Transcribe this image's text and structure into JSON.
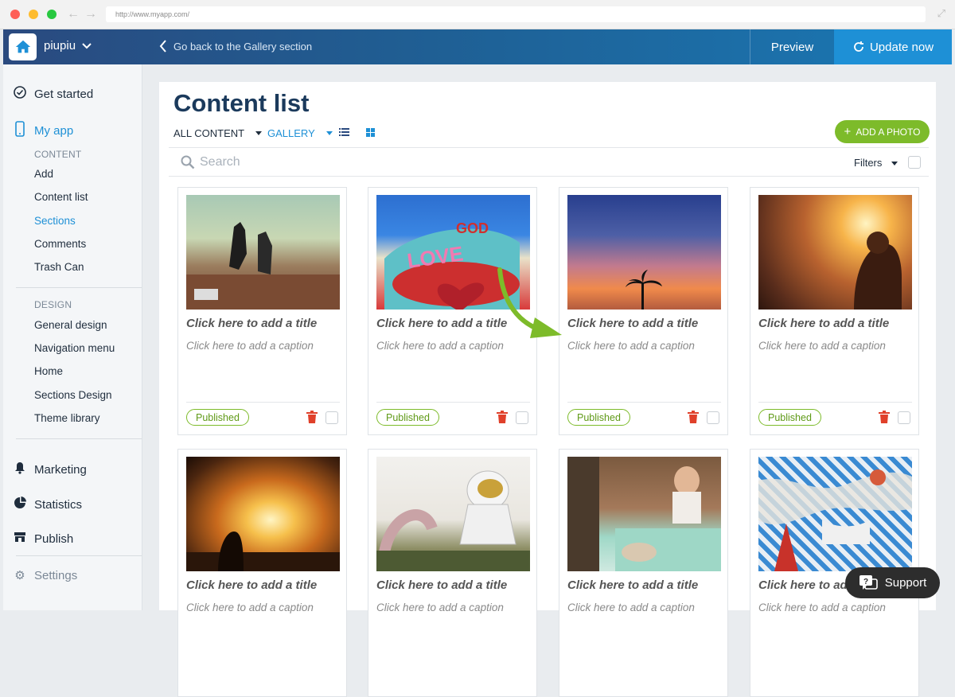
{
  "browser": {
    "url": "http://www.myapp.com/"
  },
  "header": {
    "app_name": "piupiu",
    "back_label": "Go back to the Gallery section",
    "preview_label": "Preview",
    "update_label": "Update now"
  },
  "sidebar": {
    "get_started": "Get started",
    "my_app": "My app",
    "content_heading": "CONTENT",
    "content_items": [
      "Add",
      "Content list",
      "Sections",
      "Comments",
      "Trash Can"
    ],
    "design_heading": "DESIGN",
    "design_items": [
      "General design",
      "Navigation menu",
      "Home",
      "Sections Design",
      "Theme library"
    ],
    "marketing": "Marketing",
    "statistics": "Statistics",
    "publish": "Publish",
    "settings": "Settings",
    "active_item": "Sections"
  },
  "main": {
    "title": "Content list",
    "filter_all": "ALL CONTENT",
    "filter_gallery": "GALLERY",
    "add_photo": "ADD A PHOTO",
    "search_placeholder": "Search",
    "filters_label": "Filters"
  },
  "cards": [
    {
      "title": "Click here to add a title",
      "caption": "Click here to add a caption",
      "status": "Published",
      "image": "concert-crowd"
    },
    {
      "title": "Click here to add a title",
      "caption": "Click here to add a caption",
      "status": "Published",
      "image": "love-mural"
    },
    {
      "title": "Click here to add a title",
      "caption": "Click here to add a caption",
      "status": "Published",
      "image": "sunset-palm"
    },
    {
      "title": "Click here to add a title",
      "caption": "Click here to add a caption",
      "status": "Published",
      "image": "festival-sunlight"
    },
    {
      "title": "Click here to add a title",
      "caption": "Click here to add a caption",
      "status": "",
      "image": "light-tunnel"
    },
    {
      "title": "Click here to add a title",
      "caption": "Click here to add a caption",
      "status": "",
      "image": "astronaut-statue"
    },
    {
      "title": "Click here to add a title",
      "caption": "Click here to add a caption",
      "status": "",
      "image": "bar-scene"
    },
    {
      "title": "Click here to add a title",
      "caption": "Click here to add a caption",
      "status": "",
      "image": "colorful-mural"
    }
  ],
  "support": {
    "label": "Support"
  },
  "colors": {
    "accent": "#1e90d6",
    "green": "#7dbb2a",
    "header": "#2a4a7f"
  }
}
